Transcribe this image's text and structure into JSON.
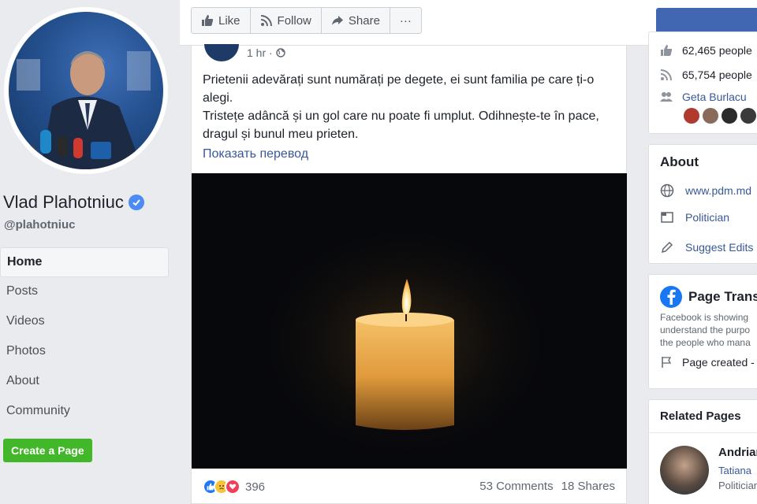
{
  "sidebar": {
    "page_name": "Vlad Plahotniuc",
    "handle": "@plahotniuc",
    "nav": [
      "Home",
      "Posts",
      "Videos",
      "Photos",
      "About",
      "Community"
    ],
    "create_page": "Create a Page"
  },
  "toolbar": {
    "like": "Like",
    "follow": "Follow",
    "share": "Share",
    "more": "···"
  },
  "post": {
    "time": "1 hr ·",
    "text_line1": "Prietenii adevărați sunt numărați pe degete, ei sunt familia pe care ți-o alegi.",
    "text_line2": "Tristețe adâncă și un gol care nu poate fi umplut. Odihnește-te în pace, dragul și bunul meu prieten.",
    "translate": "Показать перевод",
    "reaction_count": "396",
    "comments": "53 Comments",
    "shares": "18 Shares"
  },
  "right": {
    "likes": "62,465 people",
    "follows": "65,754 people",
    "friend": "Geta Burlacu",
    "about_title": "About",
    "website": "www.pdm.md",
    "category": "Politician",
    "suggest": "Suggest Edits",
    "transparency_title": "Page Trans",
    "transparency_text": [
      "Facebook is showing",
      "understand the purpo",
      "the people who mana"
    ],
    "page_created": "Page created -",
    "related_title": "Related Pages",
    "related_name": "Andrian",
    "related_sub": "Tatiana",
    "related_cat": "Politician"
  },
  "colors": {
    "accent": "#4267b2",
    "link": "#385898",
    "green": "#42b72a",
    "verified": "#4c8bf5"
  }
}
